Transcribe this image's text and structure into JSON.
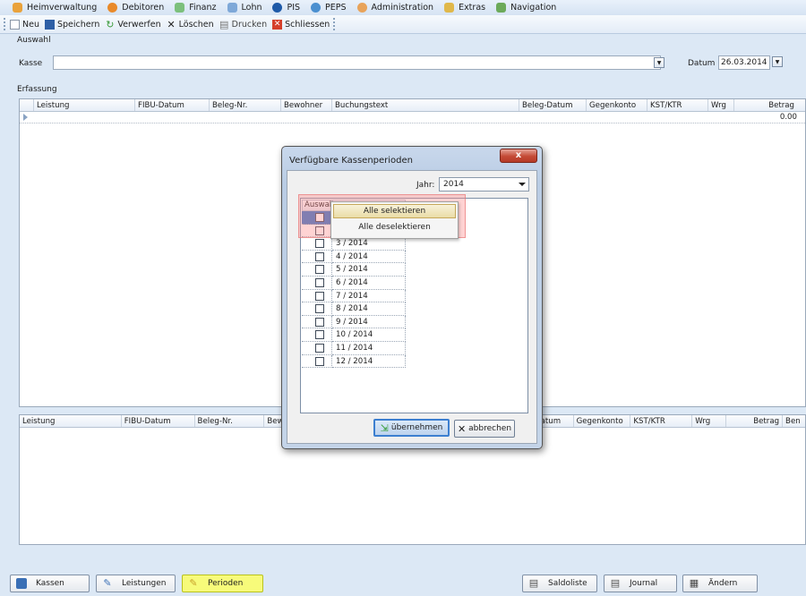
{
  "menubar": {
    "items": [
      {
        "label": "Heimverwaltung",
        "icon": "home-icon",
        "color": "#e9a23b"
      },
      {
        "label": "Debitoren",
        "icon": "person-icon",
        "color": "#e98a2a"
      },
      {
        "label": "Finanz",
        "icon": "finance-icon",
        "color": "#7cc07c"
      },
      {
        "label": "Lohn",
        "icon": "card-icon",
        "color": "#7ea8d8"
      },
      {
        "label": "PIS",
        "icon": "info-icon",
        "color": "#1e5aa8"
      },
      {
        "label": "PEPS",
        "icon": "globe-icon",
        "color": "#4a8fd0"
      },
      {
        "label": "Administration",
        "icon": "admin-icon",
        "color": "#e8a35a"
      },
      {
        "label": "Extras",
        "icon": "wrench-icon",
        "color": "#e0b84a"
      },
      {
        "label": "Navigation",
        "icon": "navigation-icon",
        "color": "#6caa5a"
      }
    ]
  },
  "toolbar": {
    "new_label": "Neu",
    "save_label": "Speichern",
    "discard_label": "Verwerfen",
    "delete_label": "Löschen",
    "print_label": "Drucken",
    "close_label": "Schliessen"
  },
  "auswahl": {
    "section_label": "Auswahl",
    "kasse_label": "Kasse",
    "datum_label": "Datum",
    "datum_value": "26.03.2014"
  },
  "erfassung": {
    "section_label": "Erfassung",
    "columns": [
      "Leistung",
      "FIBU-Datum",
      "Beleg-Nr.",
      "Bewohner",
      "Buchungstext",
      "Beleg-Datum",
      "Gegenkonto",
      "KST/KTR",
      "Wrg",
      "Betrag"
    ],
    "row_value": "0.00"
  },
  "lower_grid": {
    "columns_left": [
      "Leistung",
      "FIBU-Datum",
      "Beleg-Nr.",
      "Bew"
    ],
    "columns_right": [
      "atum",
      "Gegenkonto",
      "KST/KTR",
      "Wrg",
      "Betrag",
      "Ben"
    ]
  },
  "dialog": {
    "title": "Verfügbare Kassenperioden",
    "close_glyph": "x",
    "year_label": "Jahr:",
    "year_value": "2014",
    "column_header": "Auswahl",
    "periods": [
      "3 / 2014",
      "4 / 2014",
      "5 / 2014",
      "6 / 2014",
      "7 / 2014",
      "8 / 2014",
      "9 / 2014",
      "10 / 2014",
      "11 / 2014",
      "12 / 2014"
    ],
    "apply_label": "übernehmen",
    "cancel_label": "abbrechen"
  },
  "context_menu": {
    "select_all": "Alle selektieren",
    "deselect_all": "Alle deselektieren"
  },
  "bottom": {
    "kassen_label": "Kassen",
    "leistungen_label": "Leistungen",
    "perioden_label": "Perioden",
    "saldoliste_label": "Saldoliste",
    "journal_label": "Journal",
    "aendern_label": "Ändern"
  }
}
